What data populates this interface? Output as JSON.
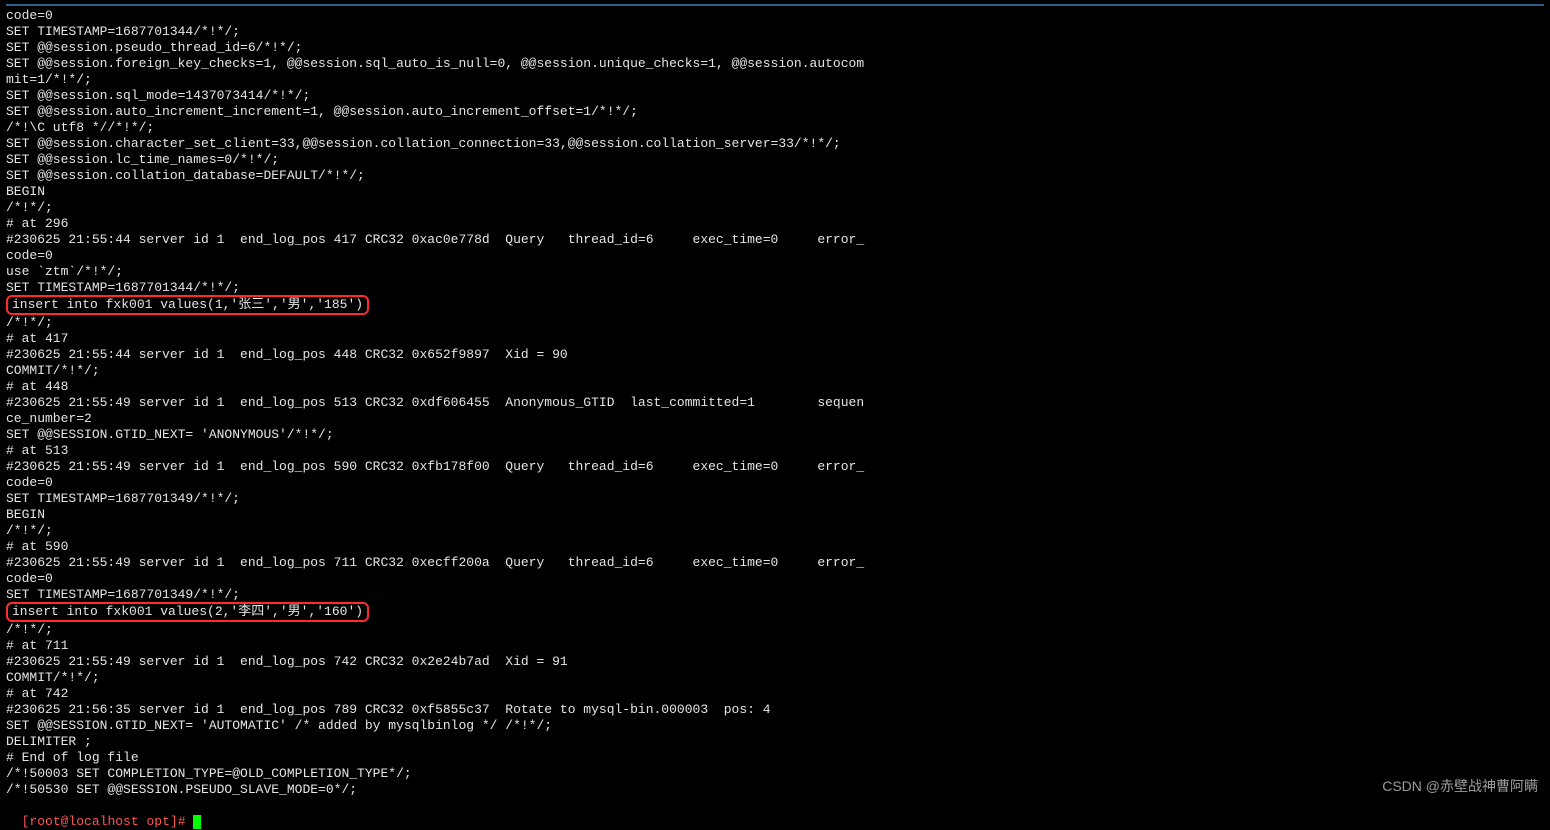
{
  "topbar": true,
  "lines": [
    {
      "t": "code=0"
    },
    {
      "t": "SET TIMESTAMP=1687701344/*!*/;"
    },
    {
      "t": "SET @@session.pseudo_thread_id=6/*!*/;"
    },
    {
      "t": "SET @@session.foreign_key_checks=1, @@session.sql_auto_is_null=0, @@session.unique_checks=1, @@session.autocom"
    },
    {
      "t": "mit=1/*!*/;"
    },
    {
      "t": "SET @@session.sql_mode=1437073414/*!*/;"
    },
    {
      "t": "SET @@session.auto_increment_increment=1, @@session.auto_increment_offset=1/*!*/;"
    },
    {
      "t": "/*!\\C utf8 *//*!*/;"
    },
    {
      "t": "SET @@session.character_set_client=33,@@session.collation_connection=33,@@session.collation_server=33/*!*/;"
    },
    {
      "t": "SET @@session.lc_time_names=0/*!*/;"
    },
    {
      "t": "SET @@session.collation_database=DEFAULT/*!*/;"
    },
    {
      "t": "BEGIN"
    },
    {
      "t": "/*!*/;"
    },
    {
      "t": "# at 296"
    },
    {
      "t": "#230625 21:55:44 server id 1  end_log_pos 417 CRC32 0xac0e778d  Query   thread_id=6     exec_time=0     error_"
    },
    {
      "t": "code=0"
    },
    {
      "t": "use `ztm`/*!*/;"
    },
    {
      "t": "SET TIMESTAMP=1687701344/*!*/;"
    },
    {
      "t": "insert into fxk001 values(1,'张三','男','185')",
      "hl": true
    },
    {
      "t": "/*!*/;"
    },
    {
      "t": "# at 417"
    },
    {
      "t": "#230625 21:55:44 server id 1  end_log_pos 448 CRC32 0x652f9897  Xid = 90"
    },
    {
      "t": "COMMIT/*!*/;"
    },
    {
      "t": "# at 448"
    },
    {
      "t": "#230625 21:55:49 server id 1  end_log_pos 513 CRC32 0xdf606455  Anonymous_GTID  last_committed=1        sequen"
    },
    {
      "t": "ce_number=2"
    },
    {
      "t": "SET @@SESSION.GTID_NEXT= 'ANONYMOUS'/*!*/;"
    },
    {
      "t": "# at 513"
    },
    {
      "t": "#230625 21:55:49 server id 1  end_log_pos 590 CRC32 0xfb178f00  Query   thread_id=6     exec_time=0     error_"
    },
    {
      "t": "code=0"
    },
    {
      "t": "SET TIMESTAMP=1687701349/*!*/;"
    },
    {
      "t": "BEGIN"
    },
    {
      "t": "/*!*/;"
    },
    {
      "t": "# at 590"
    },
    {
      "t": "#230625 21:55:49 server id 1  end_log_pos 711 CRC32 0xecff200a  Query   thread_id=6     exec_time=0     error_"
    },
    {
      "t": "code=0"
    },
    {
      "t": "SET TIMESTAMP=1687701349/*!*/;"
    },
    {
      "t": "insert into fxk001 values(2,'李四','男','160')",
      "hl": true
    },
    {
      "t": "/*!*/;"
    },
    {
      "t": "# at 711"
    },
    {
      "t": "#230625 21:55:49 server id 1  end_log_pos 742 CRC32 0x2e24b7ad  Xid = 91"
    },
    {
      "t": "COMMIT/*!*/;"
    },
    {
      "t": "# at 742"
    },
    {
      "t": "#230625 21:56:35 server id 1  end_log_pos 789 CRC32 0xf5855c37  Rotate to mysql-bin.000003  pos: 4"
    },
    {
      "t": "SET @@SESSION.GTID_NEXT= 'AUTOMATIC' /* added by mysqlbinlog */ /*!*/;"
    },
    {
      "t": "DELIMITER ;"
    },
    {
      "t": "# End of log file"
    },
    {
      "t": "/*!50003 SET COMPLETION_TYPE=@OLD_COMPLETION_TYPE*/;"
    },
    {
      "t": "/*!50530 SET @@SESSION.PSEUDO_SLAVE_MODE=0*/;"
    }
  ],
  "prompt": {
    "user": "root",
    "at": "@",
    "host": "localhost",
    "path": " opt",
    "suffix": "]# "
  },
  "watermark": "CSDN @赤壁战神曹阿瞒"
}
